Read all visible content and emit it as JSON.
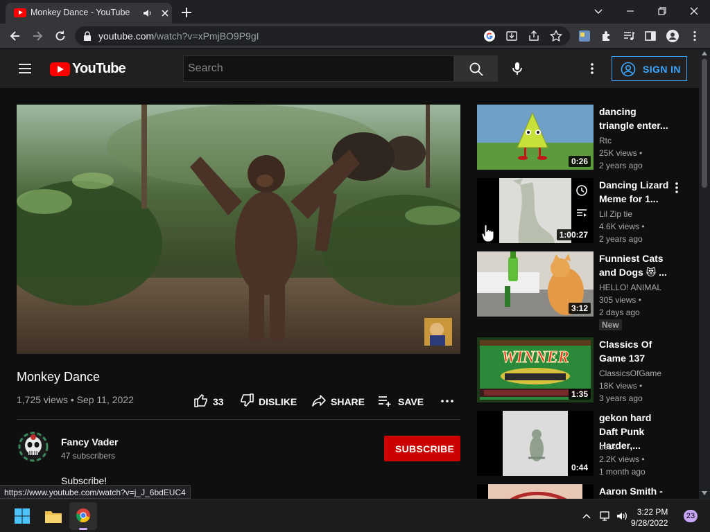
{
  "browser": {
    "tab_title": "Monkey Dance - YouTube",
    "url_host": "youtube.com",
    "url_path": "/watch?v=xPmjBO9P9gI",
    "extension_badge": "5",
    "status_url": "https://www.youtube.com/watch?v=j_J_6bdEUC4"
  },
  "yt": {
    "logo_text": "YouTube",
    "search_placeholder": "Search",
    "signin_label": "SIGN IN"
  },
  "video": {
    "title": "Monkey Dance",
    "meta": "1,725 views • Sep 11, 2022",
    "likes": "33",
    "dislike_label": "DISLIKE",
    "share_label": "SHARE",
    "save_label": "SAVE"
  },
  "channel": {
    "name": "Fancy Vader",
    "subscribers": "47 subscribers",
    "subscribe_label": "SUBSCRIBE",
    "description": "Subscribe!"
  },
  "recommendations": [
    {
      "title": "dancing triangle enter...",
      "channel": "Rtc",
      "views": "25K views •",
      "age": "2 years ago",
      "duration": "0:26"
    },
    {
      "title": "Dancing Lizard Meme for 1...",
      "channel": "Lil Zip tie",
      "views": "4.6K views •",
      "age": "2 years ago",
      "duration": "1:00:27"
    },
    {
      "title": "Funniest Cats and Dogs 😻 ...",
      "channel": "HELLO! ANIMAL",
      "views": "305 views •",
      "age": "2 days ago",
      "duration": "3:12",
      "badge": "New"
    },
    {
      "title": "Classics Of Game 137",
      "channel": "ClassicsOfGame",
      "views": "18K views •",
      "age": "3 years ago",
      "duration": "1:35",
      "thumb_text": "WINNER"
    },
    {
      "title": "gekon hard Daft Punk Harder,...",
      "channel": "boba",
      "views": "2.2K views •",
      "age": "1 month ago",
      "duration": "0:44"
    },
    {
      "title": "Aaron Smith -"
    }
  ],
  "taskbar": {
    "time": "3:22 PM",
    "date": "9/28/2022",
    "notifications": "23"
  },
  "colors": {
    "yt_red": "#ff0000",
    "subscribe_red": "#cc0000",
    "signin_blue": "#3ea6ff",
    "page_bg": "#0f0f0f"
  }
}
